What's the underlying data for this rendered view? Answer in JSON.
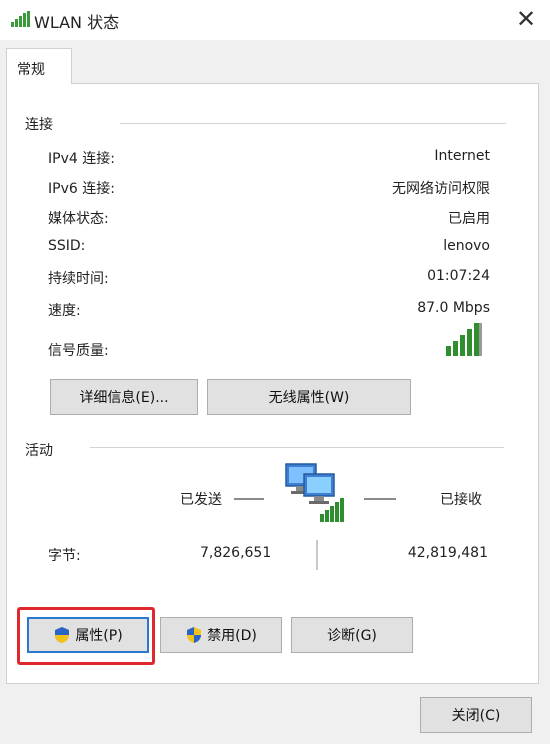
{
  "window": {
    "title": "WLAN 状态",
    "close_glyph": "✕"
  },
  "tabs": [
    {
      "label": "常规"
    }
  ],
  "connection": {
    "section_label": "连接",
    "rows": [
      {
        "label": "IPv4 连接:",
        "value": "Internet"
      },
      {
        "label": "IPv6 连接:",
        "value": "无网络访问权限"
      },
      {
        "label": "媒体状态:",
        "value": "已启用"
      },
      {
        "label": "SSID:",
        "value": "lenovo"
      },
      {
        "label": "持续时间:",
        "value": "01:07:24"
      },
      {
        "label": "速度:",
        "value": "87.0 Mbps"
      },
      {
        "label": "信号质量:",
        "value": ""
      }
    ],
    "signal_level": "5/5",
    "buttons": {
      "details": "详细信息(E)...",
      "wireless_props": "无线属性(W)"
    }
  },
  "activity": {
    "section_label": "活动",
    "sent_label": "已发送",
    "received_label": "已接收",
    "bytes_label": "字节:",
    "bytes_sent": "7,826,651",
    "bytes_received": "42,819,481"
  },
  "bottom_buttons": {
    "properties": "属性(P)",
    "disable": "禁用(D)",
    "diagnose": "诊断(G)"
  },
  "footer": {
    "close": "关闭(C)"
  },
  "icons": {
    "title": "wifi-signal-icon",
    "network": "network-computers-icon",
    "shield": "uac-shield-icon"
  },
  "colors": {
    "highlight": "#e0292f",
    "signal": "#3a9a3a",
    "focus": "#2b78d0"
  }
}
